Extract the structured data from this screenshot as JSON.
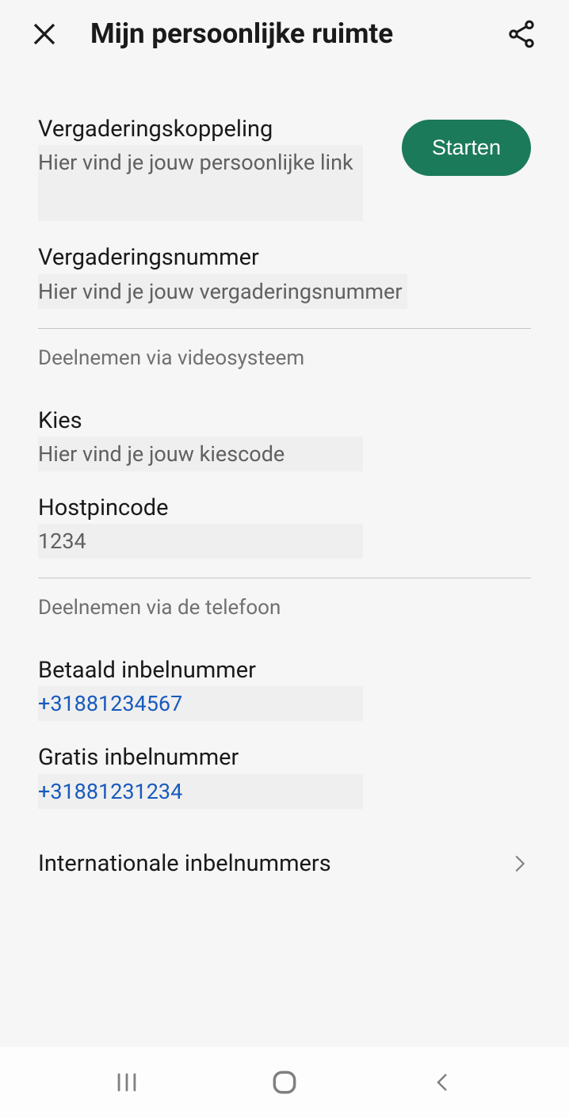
{
  "header": {
    "title": "Mijn persoonlijke ruimte"
  },
  "meeting_link": {
    "label": "Vergaderingskoppeling",
    "value": "Hier vind je jouw persoonlijke link",
    "start_label": "Starten"
  },
  "meeting_number": {
    "label": "Vergaderingsnummer",
    "value": "Hier vind je jouw vergaderingsnummer"
  },
  "video_section": {
    "header": "Deelnemen via videosysteem",
    "dial": {
      "label": "Kies",
      "value": "Hier vind je jouw kiescode"
    },
    "hostpin": {
      "label": "Hostpincode",
      "value": "1234"
    }
  },
  "phone_section": {
    "header": "Deelnemen via de telefoon",
    "toll": {
      "label": "Betaald inbelnummer",
      "value": "+31881234567"
    },
    "free": {
      "label": "Gratis inbelnummer",
      "value": "+31881231234"
    },
    "intl_label": "Internationale inbelnummers"
  }
}
